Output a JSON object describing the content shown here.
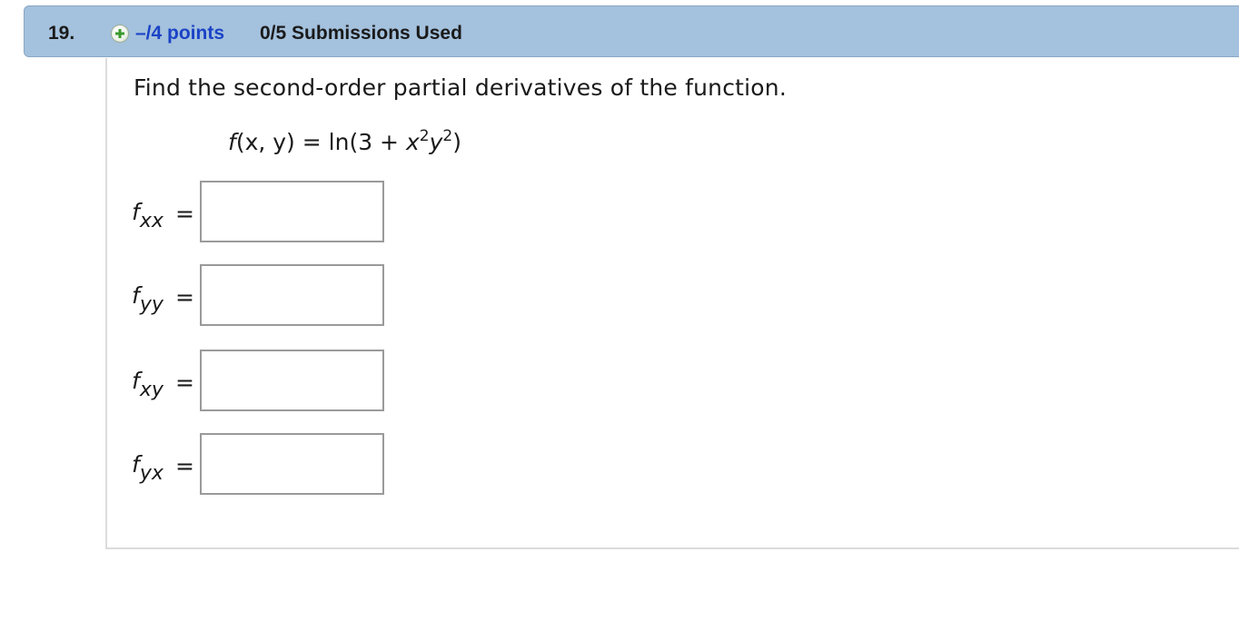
{
  "question": {
    "number": "19.",
    "points": "–/4 points",
    "submissions": "0/5 Submissions Used",
    "plus_icon": "plus-circle-icon",
    "accent_color": "#1b43c6",
    "header_color": "#a4c1dd"
  },
  "problem": {
    "instruction": "Find the second-order partial derivatives of the function.",
    "function": {
      "lhs_f": "f",
      "lhs_args": "(x, y)",
      "equals": " = ln(3 + ",
      "x": "x",
      "x_exp": "2",
      "y": "y",
      "y_exp": "2",
      "close": ")"
    }
  },
  "answers": [
    {
      "f": "f",
      "sub": "xx",
      "eq": "=",
      "value": ""
    },
    {
      "f": "f",
      "sub": "yy",
      "eq": "=",
      "value": ""
    },
    {
      "f": "f",
      "sub": "xy",
      "eq": "=",
      "value": ""
    },
    {
      "f": "f",
      "sub": "yx",
      "eq": "=",
      "value": ""
    }
  ]
}
